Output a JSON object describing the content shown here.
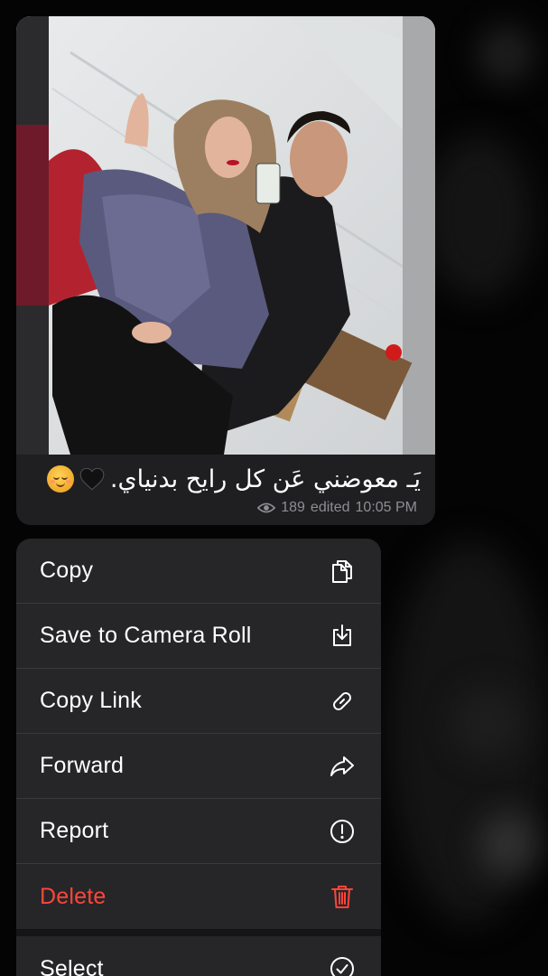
{
  "message": {
    "caption": "يَـ معوضني عَن كل رايح بدنياي.",
    "emojis": [
      "relieved-face",
      "black-heart"
    ],
    "views": "189",
    "status": "edited",
    "time": "10:05 PM"
  },
  "menu": {
    "items": [
      {
        "label": "Copy",
        "icon": "copy-icon"
      },
      {
        "label": "Save to Camera Roll",
        "icon": "download-icon"
      },
      {
        "label": "Copy Link",
        "icon": "link-icon"
      },
      {
        "label": "Forward",
        "icon": "forward-icon"
      },
      {
        "label": "Report",
        "icon": "report-icon"
      },
      {
        "label": "Delete",
        "icon": "trash-icon",
        "danger": true
      },
      {
        "label": "Select",
        "icon": "checkmark-circle-icon"
      }
    ]
  },
  "colors": {
    "menu_background": "#262628",
    "bubble_background": "#1f1f21",
    "danger": "#ff453a",
    "meta_text": "#8e8e93"
  }
}
